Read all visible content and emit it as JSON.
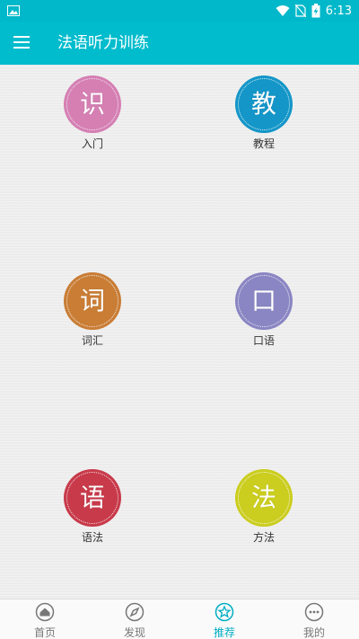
{
  "status_bar": {
    "time": "6:13"
  },
  "app_bar": {
    "title": "法语听力训练",
    "menu_icon": "hamburger-menu-icon"
  },
  "tiles": [
    {
      "char": "识",
      "label": "入门",
      "color": "#d57fb3"
    },
    {
      "char": "教",
      "label": "教程",
      "color": "#1496c8"
    },
    {
      "char": "词",
      "label": "词汇",
      "color": "#c97d35"
    },
    {
      "char": "口",
      "label": "口语",
      "color": "#8a86c3"
    },
    {
      "char": "语",
      "label": "语法",
      "color": "#c83a4a"
    },
    {
      "char": "法",
      "label": "方法",
      "color": "#cbcd1f"
    }
  ],
  "bottom_nav": {
    "items": [
      {
        "label": "首页",
        "icon": "home-icon"
      },
      {
        "label": "发现",
        "icon": "compass-icon"
      },
      {
        "label": "推荐",
        "icon": "star-icon",
        "active": true
      },
      {
        "label": "我的",
        "icon": "more-dots-icon"
      }
    ],
    "active_color": "#00aec2"
  }
}
